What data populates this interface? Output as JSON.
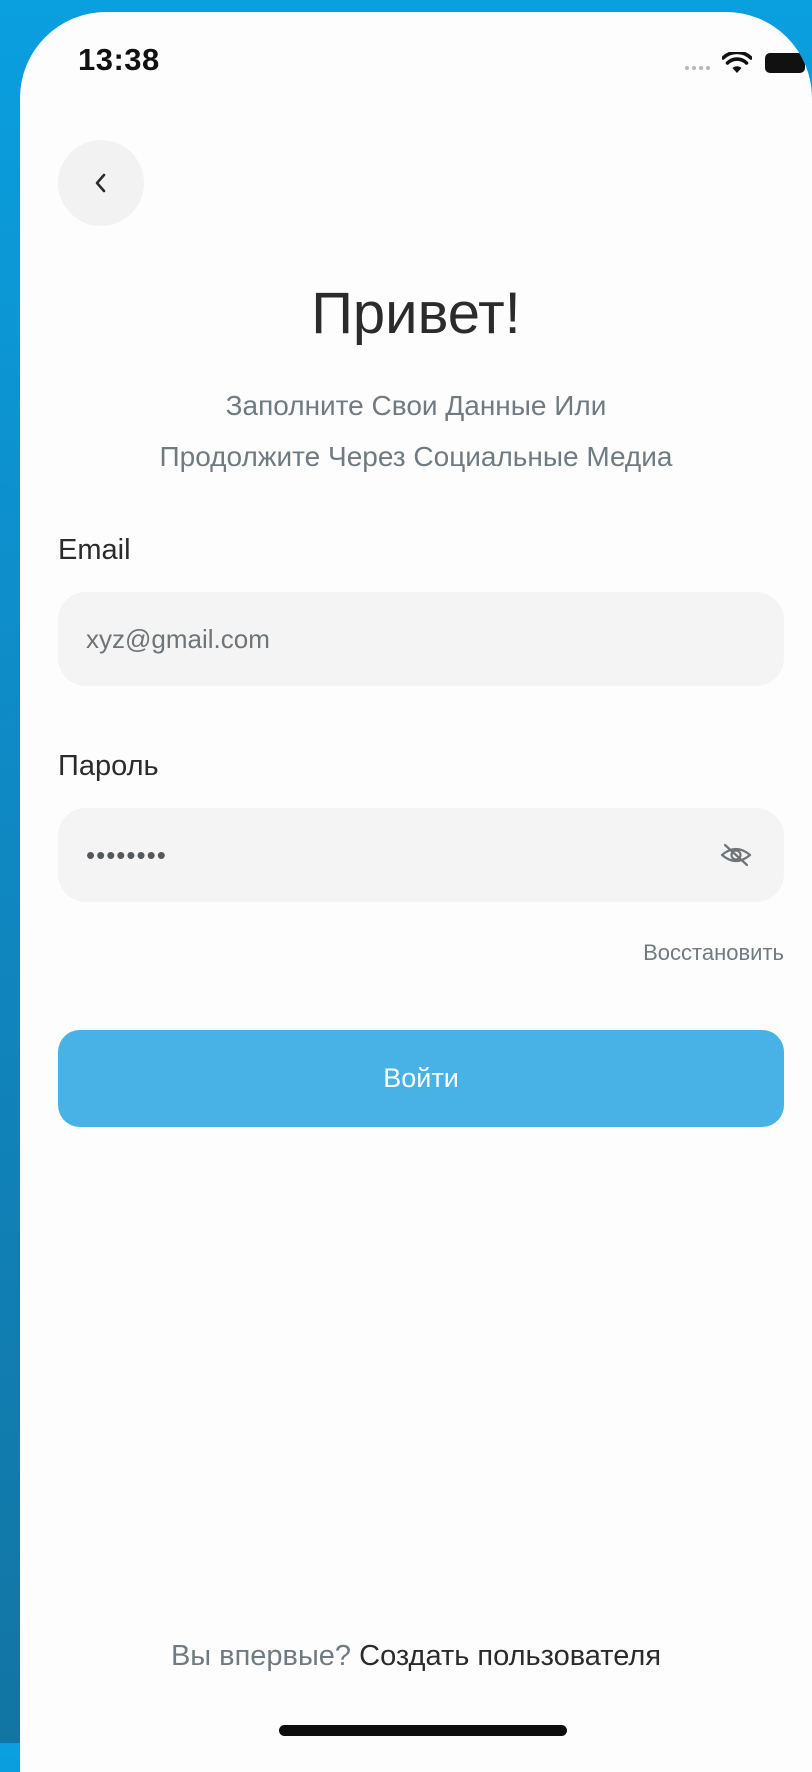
{
  "status_bar": {
    "time": "13:38"
  },
  "header": {
    "back_icon": "chevron-left-icon",
    "title": "Привет!",
    "subtitle_line1": "Заполните Свои Данные Или",
    "subtitle_line2": "Продолжите Через Социальные Медиа"
  },
  "form": {
    "email_label": "Email",
    "email_value": "xyz@gmail.com",
    "password_label": "Пароль",
    "password_value": "••••••••",
    "password_visibility_icon": "eye-off-icon",
    "recover_label": "Восстановить",
    "submit_label": "Войти"
  },
  "footer": {
    "question": "Вы впервые?",
    "create_link": "Создать пользователя"
  },
  "colors": {
    "background_gradient_top": "#0a9fdf",
    "background_gradient_bottom": "#1275a3",
    "accent": "#48b2e7",
    "input_background": "#f4f4f4",
    "muted_text": "#707b81",
    "primary_text": "#2b2b2b"
  }
}
